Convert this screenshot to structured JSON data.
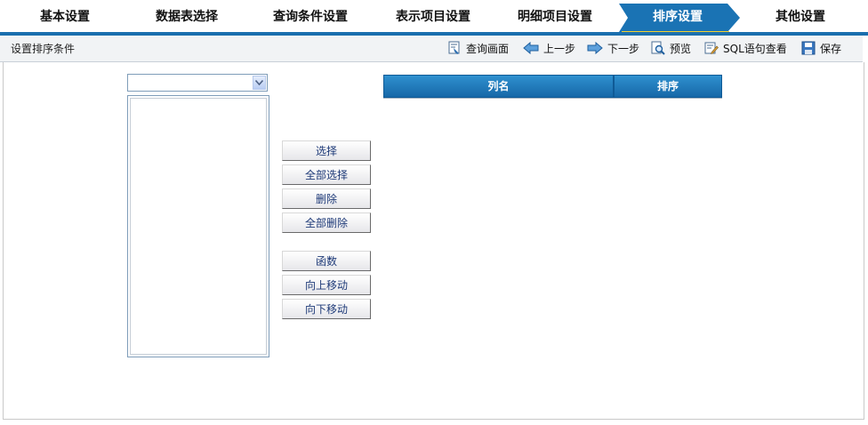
{
  "steps": [
    {
      "label": "基本设置"
    },
    {
      "label": "数据表选择"
    },
    {
      "label": "查询条件设置"
    },
    {
      "label": "表示项目设置"
    },
    {
      "label": "明细项目设置"
    },
    {
      "label": "排序设置"
    },
    {
      "label": "其他设置"
    }
  ],
  "active_step": "排序设置",
  "toolbar": {
    "title": "设置排序条件",
    "query_screen": "查询画面",
    "prev": "上一步",
    "next": "下一步",
    "preview": "预览",
    "sql_view": "SQL语句查看",
    "save": "保存"
  },
  "column_select": {
    "value": ""
  },
  "buttons": {
    "select": "选择",
    "select_all": "全部选择",
    "delete": "删除",
    "delete_all": "全部删除",
    "function": "函数",
    "move_up": "向上移动",
    "move_down": "向下移动"
  },
  "sort_table": {
    "headers": [
      "列名",
      "排序"
    ]
  },
  "colors": {
    "accent_blue": "#1a6fae",
    "active_tab": "#1a73b4",
    "active_underline": "#f5d230",
    "header_blue": "#1f7bbd"
  },
  "icons": {
    "query_screen": "query-screen-icon",
    "prev": "arrow-left-icon",
    "next": "arrow-right-icon",
    "preview": "preview-magnifier-icon",
    "sql_view": "sql-edit-icon",
    "save": "save-floppy-icon"
  }
}
